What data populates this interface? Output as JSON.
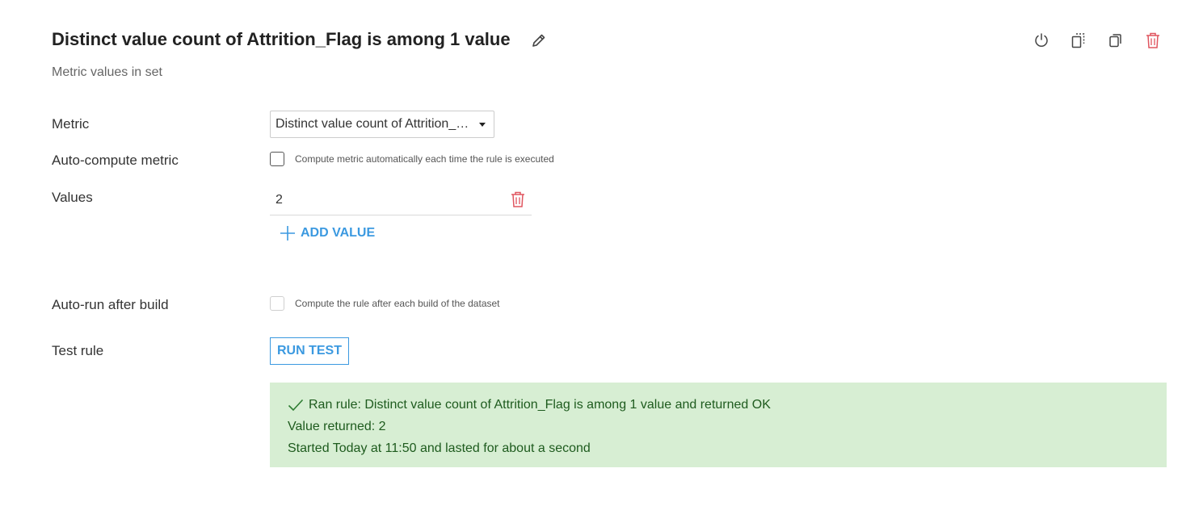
{
  "header": {
    "title": "Distinct value count of Attrition_Flag is among 1 value",
    "subtitle": "Metric values in set",
    "actions": [
      {
        "icon": "power-icon"
      },
      {
        "icon": "duplicate-icon"
      },
      {
        "icon": "copy-icon"
      },
      {
        "icon": "trash-icon"
      }
    ]
  },
  "form": {
    "metric": {
      "label": "Metric",
      "selected": "Distinct value count of Attrition_Flag (Attrition_Flag)"
    },
    "auto_compute": {
      "label": "Auto-compute metric",
      "checkbox_label": "Compute metric automatically each time the rule is executed",
      "checked": false
    },
    "values": {
      "label": "Values",
      "items": [
        "2"
      ],
      "add_label": "ADD VALUE"
    },
    "auto_run": {
      "label": "Auto-run after build",
      "checkbox_label": "Compute the rule after each build of the dataset",
      "checked": false,
      "disabled": true
    },
    "test_rule": {
      "label": "Test rule",
      "button_label": "RUN TEST"
    }
  },
  "result": {
    "status": "OK",
    "line1": "Ran rule: Distinct value count of Attrition_Flag is among 1 value and returned OK",
    "line2": "Value returned: 2",
    "line3": "Started Today at 11:50 and lasted for about a second"
  },
  "colors": {
    "accent": "#3b99e0",
    "danger": "#e0555f",
    "success_bg": "#d7eed3",
    "success_text": "#1e5b1e"
  }
}
